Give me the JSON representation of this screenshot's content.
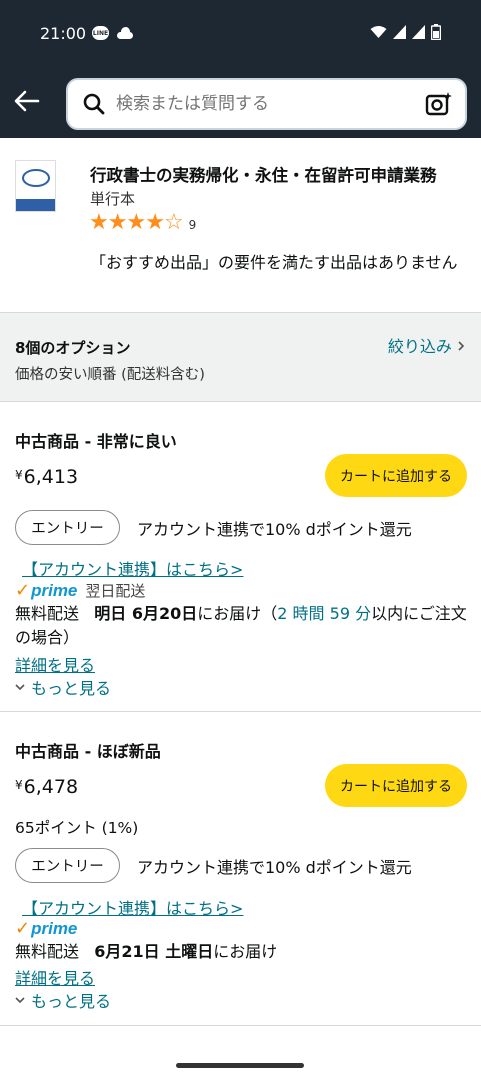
{
  "status_bar": {
    "time": "21:00",
    "line_badge": "LINE",
    "left_icons": [
      "line-icon",
      "cloud-icon"
    ],
    "right_icons": [
      "wifi-icon",
      "signal-icon",
      "signal-icon",
      "battery-icon"
    ]
  },
  "search": {
    "placeholder": "検索または質問する"
  },
  "product": {
    "title": "行政書士の実務帰化・永住・在留許可申請業務",
    "binding": "単行本",
    "rating_stars": 4,
    "rating_count": "9",
    "note": "「おすすめ出品」の要件を満たす出品はありません"
  },
  "options": {
    "count_label": "8個のオプション",
    "sort_label": "価格の安い順番 (配送料含む)",
    "filter_label": "絞り込み"
  },
  "offers": [
    {
      "condition": "中古商品 - 非常に良い",
      "currency": "¥",
      "price": "6,413",
      "cart_label": "カートに追加する",
      "entry_label": "エントリー",
      "entry_text": "アカウント連携で10% dポイント還元",
      "account_link": "【アカウント連携】はこちら>",
      "prime_word": "prime",
      "prime_label": "翌日配送",
      "delivery_prefix": "無料配送",
      "delivery_date": "明日 6月20日",
      "delivery_mid": "にお届け（",
      "delivery_countdown": "2 時間 59 分",
      "delivery_suffix": "以内にご注文の場合）",
      "details_link": "詳細を見る",
      "more_label": "もっと見る"
    },
    {
      "condition": "中古商品 - ほぼ新品",
      "currency": "¥",
      "price": "6,478",
      "points": "65ポイント (1%)",
      "cart_label": "カートに追加する",
      "entry_label": "エントリー",
      "entry_text": "アカウント連携で10% dポイント還元",
      "account_link": "【アカウント連携】はこちら>",
      "prime_word": "prime",
      "delivery_prefix": "無料配送",
      "delivery_date": "6月21日 土曜日",
      "delivery_mid": "にお届け",
      "details_link": "詳細を見る",
      "more_label": "もっと見る"
    }
  ],
  "colors": {
    "header_bg": "#1e2833",
    "link": "#007185",
    "cart_button": "#ffd814",
    "star": "#ff8d1a",
    "prime_blue": "#1196d2",
    "prime_check": "#f08804"
  }
}
